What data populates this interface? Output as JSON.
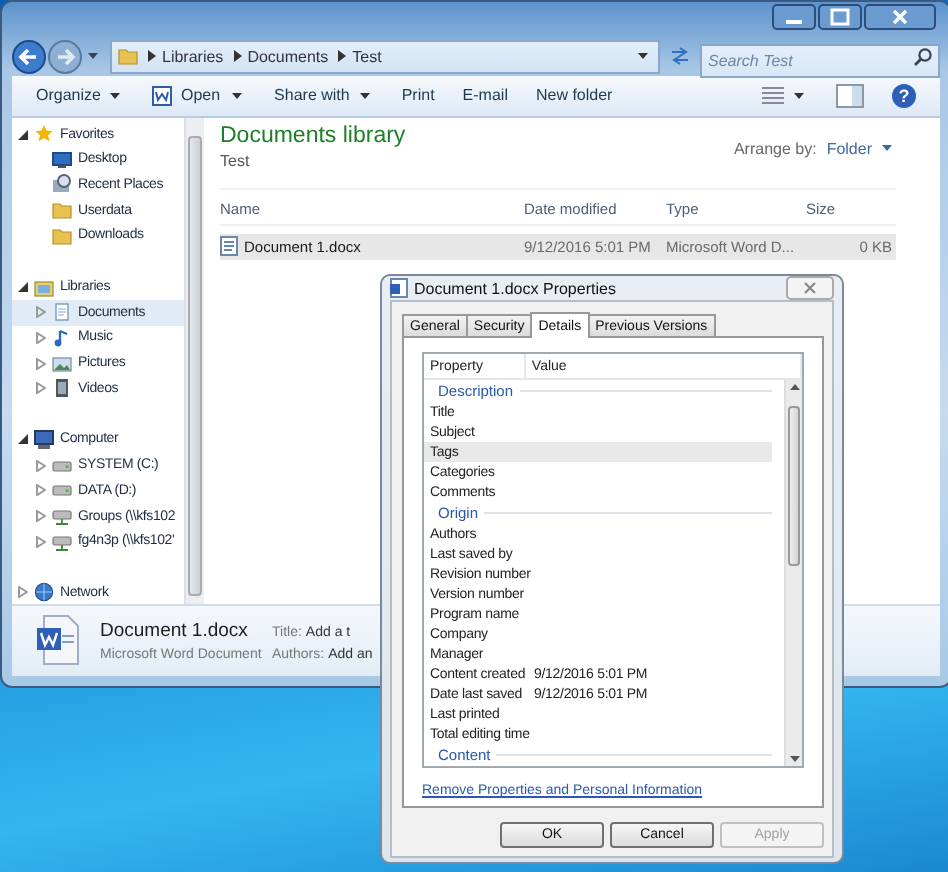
{
  "explorer": {
    "help_button": "?",
    "address": {
      "breadcrumbs": [
        "Libraries",
        "Documents",
        "Test"
      ]
    },
    "search": {
      "placeholder": "Search Test"
    },
    "toolbar": [
      {
        "label": "Organize",
        "kind": "menu"
      },
      {
        "label": "Open",
        "kind": "split"
      },
      {
        "label": "Share with",
        "kind": "menu"
      },
      {
        "label": "Print",
        "kind": "plain"
      },
      {
        "label": "E-mail",
        "kind": "plain"
      },
      {
        "label": "New folder",
        "kind": "plain"
      }
    ],
    "nav_tree": [
      {
        "label": "Favorites",
        "expanded": true,
        "selected": false,
        "children": [
          {
            "label": "Desktop",
            "selected": false
          },
          {
            "label": "Recent Places",
            "selected": false
          },
          {
            "label": "Userdata",
            "selected": false
          },
          {
            "label": "Downloads",
            "selected": false
          }
        ]
      },
      {
        "label": "Libraries",
        "expanded": true,
        "selected": false,
        "children": [
          {
            "label": "Documents",
            "expanded": false,
            "selected": true
          },
          {
            "label": "Music",
            "expanded": false,
            "selected": false
          },
          {
            "label": "Pictures",
            "expanded": false,
            "selected": false
          },
          {
            "label": "Videos",
            "expanded": false,
            "selected": false
          }
        ]
      },
      {
        "label": "Computer",
        "expanded": true,
        "selected": false,
        "children": [
          {
            "label": "SYSTEM (C:)",
            "expanded": false,
            "selected": false
          },
          {
            "label": "DATA (D:)",
            "expanded": false,
            "selected": false
          },
          {
            "label": "Groups (\\\\kfs102",
            "expanded": false,
            "selected": false
          },
          {
            "label": "fg4n3p (\\\\kfs102'",
            "expanded": false,
            "selected": false
          }
        ]
      },
      {
        "label": "Network",
        "expanded": false,
        "selected": false
      }
    ],
    "library": {
      "title": "Documents library",
      "subtitle": "Test",
      "arrange_label": "Arrange by:",
      "arrange_value": "Folder"
    },
    "columns": [
      "Name",
      "Date modified",
      "Type",
      "Size"
    ],
    "files": [
      {
        "cells": [
          "Document 1.docx",
          "9/12/2016 5:01 PM",
          "Microsoft Word D...",
          "0 KB"
        ],
        "selected": true
      }
    ],
    "details_pane": {
      "name": "Document 1.docx",
      "type": "Microsoft Word Document",
      "fields": [
        {
          "label": "Title:",
          "value": "Add a t"
        },
        {
          "label": "Authors:",
          "value": "Add an"
        }
      ]
    }
  },
  "dialog": {
    "title": "Document 1.docx Properties",
    "tabs": [
      {
        "label": "General",
        "selected": false
      },
      {
        "label": "Security",
        "selected": false
      },
      {
        "label": "Details",
        "selected": true
      },
      {
        "label": "Previous Versions",
        "selected": false
      }
    ],
    "columns": [
      "Property",
      "Value"
    ],
    "groups": [
      {
        "heading": "Description",
        "rows": [
          {
            "property": "Title",
            "selected": false
          },
          {
            "property": "Subject",
            "selected": false
          },
          {
            "property": "Tags",
            "selected": true
          },
          {
            "property": "Categories",
            "selected": false
          },
          {
            "property": "Comments",
            "selected": false
          }
        ]
      },
      {
        "heading": "Origin",
        "rows": [
          {
            "property": "Authors",
            "selected": false
          },
          {
            "property": "Last saved by",
            "selected": false
          },
          {
            "property": "Revision number",
            "selected": false
          },
          {
            "property": "Version number",
            "selected": false
          },
          {
            "property": "Program name",
            "selected": false
          },
          {
            "property": "Company",
            "selected": false
          },
          {
            "property": "Manager",
            "selected": false
          },
          {
            "property": "Content created",
            "value": "9/12/2016 5:01 PM",
            "selected": false
          },
          {
            "property": "Date last saved",
            "value": "9/12/2016 5:01 PM",
            "selected": false
          },
          {
            "property": "Last printed",
            "selected": false
          },
          {
            "property": "Total editing time",
            "selected": false
          }
        ]
      },
      {
        "heading": "Content"
      }
    ],
    "link": "Remove Properties and Personal Information",
    "buttons": [
      {
        "label": "OK",
        "disabled": false
      },
      {
        "label": "Cancel",
        "disabled": false
      },
      {
        "label": "Apply",
        "disabled": true
      }
    ]
  }
}
